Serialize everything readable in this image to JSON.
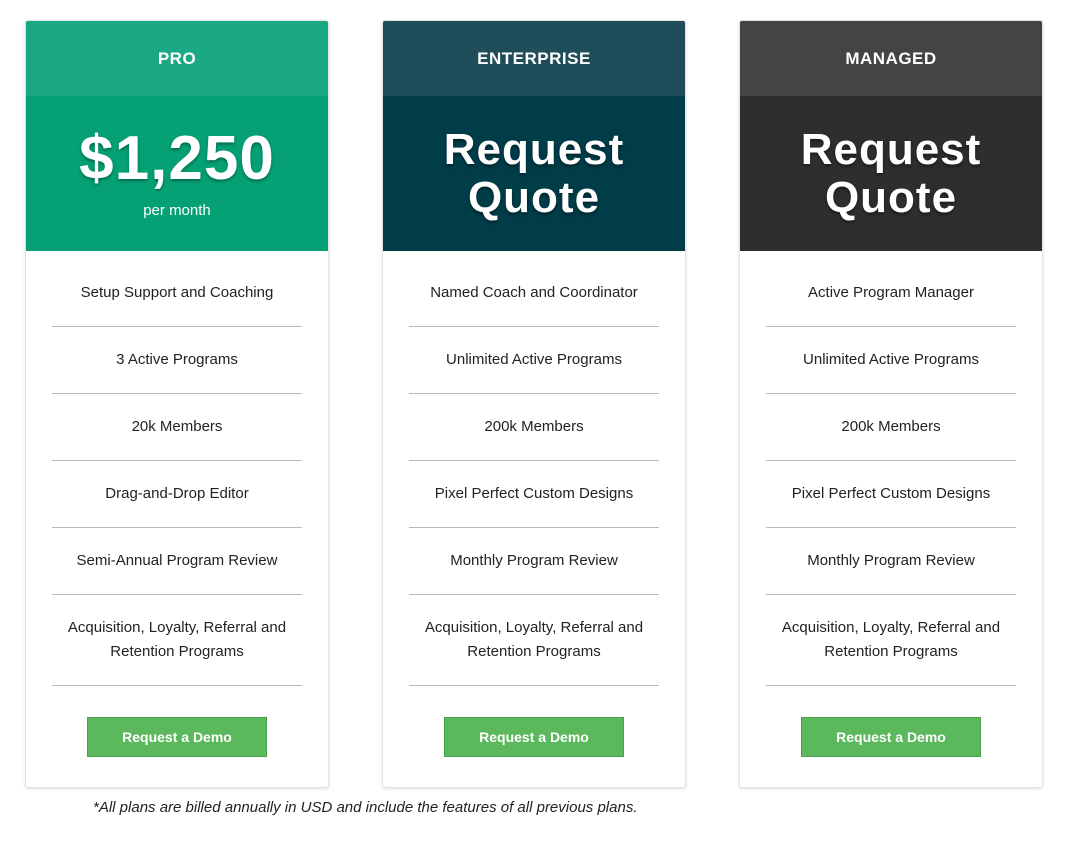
{
  "plans": [
    {
      "name": "PRO",
      "price": "$1,250",
      "period": "per month",
      "features": [
        "Setup Support and Coaching",
        "3 Active Programs",
        "20k Members",
        "Drag-and-Drop Editor",
        "Semi-Annual Program Review",
        "Acquisition, Loyalty, Referral and Retention Programs"
      ],
      "button_label": "Request a Demo",
      "colors": {
        "header": "#1aa984",
        "price": "#05a174"
      }
    },
    {
      "name": "ENTERPRISE",
      "price_line1": "Request",
      "price_line2": "Quote",
      "features": [
        "Named Coach and Coordinator",
        "Unlimited Active Programs",
        "200k Members",
        "Pixel Perfect Custom Designs",
        "Monthly Program Review",
        "Acquisition, Loyalty, Referral and Retention Programs"
      ],
      "button_label": "Request a Demo",
      "colors": {
        "header": "#1f4e5a",
        "price": "#013d49"
      }
    },
    {
      "name": "MANAGED",
      "price_line1": "Request",
      "price_line2": "Quote",
      "features": [
        "Active Program Manager",
        "Unlimited Active Programs",
        "200k Members",
        "Pixel Perfect Custom Designs",
        "Monthly Program Review",
        "Acquisition, Loyalty, Referral and Retention Programs"
      ],
      "button_label": "Request a Demo",
      "colors": {
        "header": "#444444",
        "price": "#2e2e2e"
      }
    }
  ],
  "button_color": "#5cb85c",
  "footnote": "*All plans are billed annually in USD and include the features of all previous plans."
}
